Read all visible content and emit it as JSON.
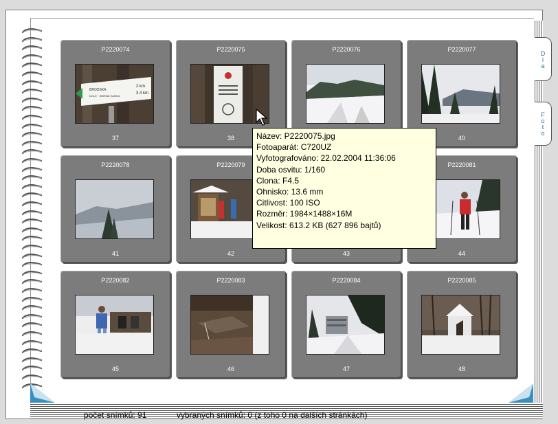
{
  "tabs": [
    {
      "label": "Dia"
    },
    {
      "label": "Foto"
    }
  ],
  "slides": [
    {
      "name": "P2220074",
      "number": "37"
    },
    {
      "name": "P2220075",
      "number": "38"
    },
    {
      "name": "P2220076",
      "number": ""
    },
    {
      "name": "P2220077",
      "number": "40"
    },
    {
      "name": "P2220078",
      "number": "41"
    },
    {
      "name": "P2220079",
      "number": "42"
    },
    {
      "name": "",
      "number": "43"
    },
    {
      "name": "P2220081",
      "number": "44"
    },
    {
      "name": "P2220082",
      "number": "45"
    },
    {
      "name": "P2220083",
      "number": "46"
    },
    {
      "name": "P2220084",
      "number": "47"
    },
    {
      "name": "P2220085",
      "number": "48"
    }
  ],
  "tooltip": {
    "lines": [
      "Název: P2220075.jpg",
      "Fotoaparát: C720UZ",
      "Vyfotografováno: 22.02.2004 11:36:06",
      "Doba osvitu: 1/160",
      "Clona: F4.5",
      "Ohnisko: 13.6 mm",
      "Citlivost: 100 ISO",
      "Rozměr: 1984×1488×16M",
      "Velikost: 613.2 KB (627 896 bajtů)"
    ]
  },
  "sign": {
    "line1": "BRODSKA",
    "line2": "DOLE · SIBRNÁ HANKA",
    "km1": "2 km",
    "km2": "3.4 km"
  },
  "status": {
    "count": "počet snímků: 91",
    "selected": "vybraných snímků: 0  (z toho 0 na dalších stránkách)"
  },
  "colors": {
    "slide": "#7c7c7c",
    "tooltip": "#ffffe1",
    "tab_text": "#2a6f8a",
    "corner": "#3b8fbf"
  }
}
